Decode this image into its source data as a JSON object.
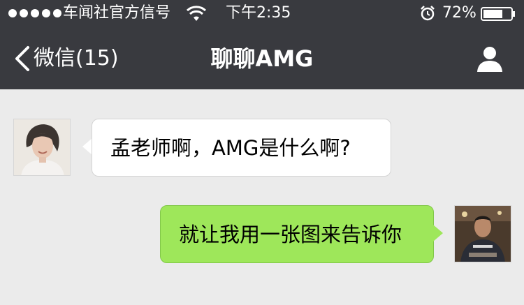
{
  "status_bar": {
    "carrier": "车闻社官方信号",
    "time": "下午2:35",
    "battery": "72%",
    "battery_level": 0.72
  },
  "nav": {
    "back_label": "微信(15)",
    "title": "聊聊AMG"
  },
  "messages": [
    {
      "side": "incoming",
      "text": "孟老师啊，AMG是什么啊?"
    },
    {
      "side": "outgoing",
      "text": "就让我用一张图来告诉你"
    }
  ],
  "colors": {
    "topbar": "#393a3f",
    "chat_background": "#ebebeb",
    "incoming_bubble": "#ffffff",
    "outgoing_bubble": "#9ee75a"
  }
}
